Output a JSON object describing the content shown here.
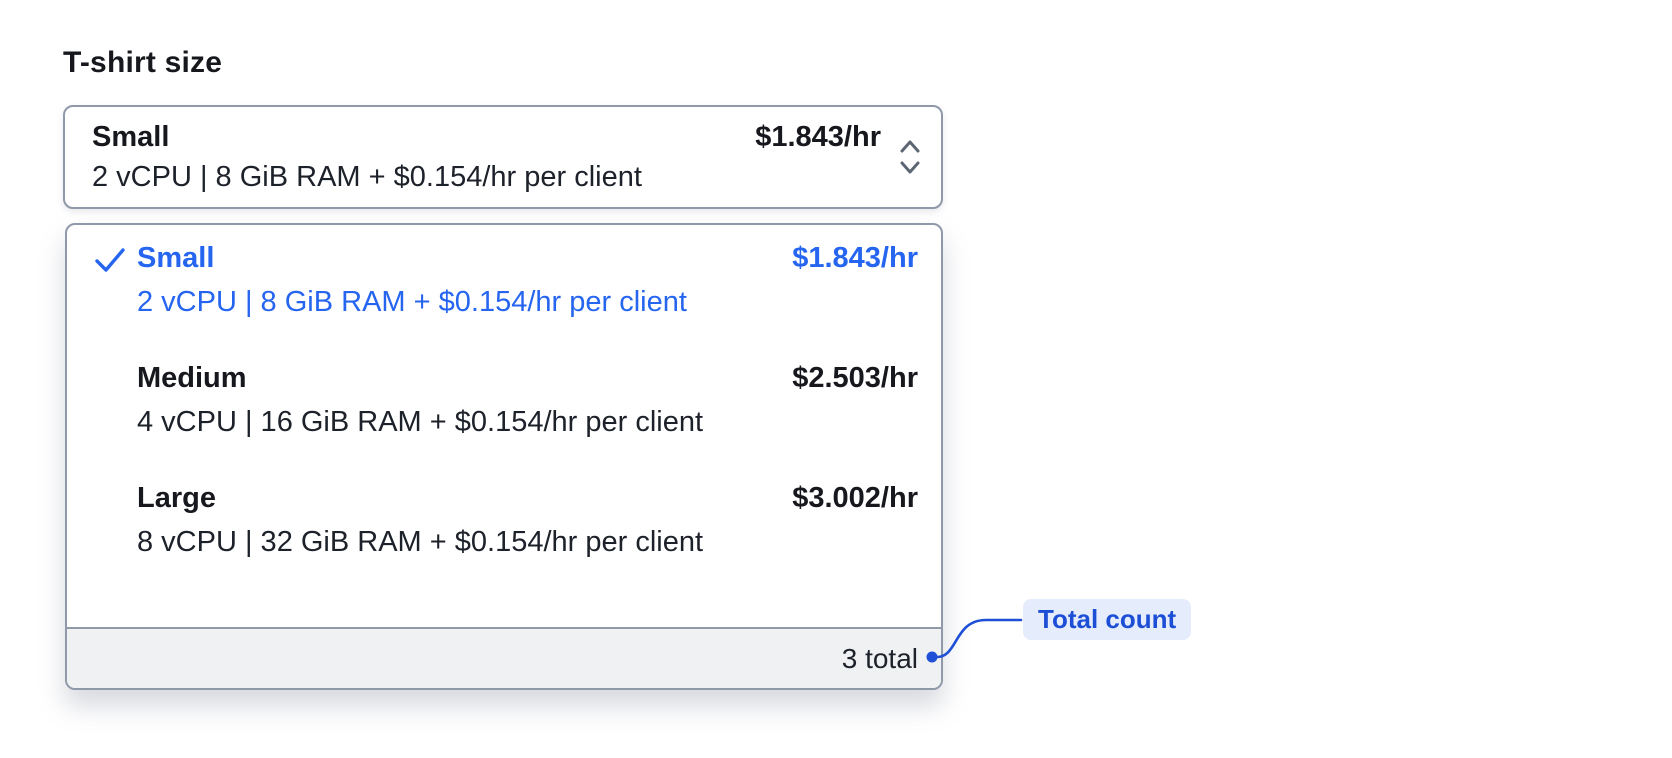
{
  "page": {
    "field_label": "T-shirt size"
  },
  "select_trigger": {
    "title": "Small",
    "subtitle": "2 vCPU | 8 GiB RAM + $0.154/hr per client",
    "price": "$1.843/hr",
    "chevron_icon": "select-updown-chevron"
  },
  "dropdown": {
    "options": [
      {
        "title": "Small",
        "subtitle": "2 vCPU | 8 GiB RAM + $0.154/hr per client",
        "price": "$1.843/hr",
        "selected": true,
        "check_icon": "checkmark"
      },
      {
        "title": "Medium",
        "subtitle": "4 vCPU | 16 GiB RAM + $0.154/hr per client",
        "price": "$2.503/hr",
        "selected": false
      },
      {
        "title": "Large",
        "subtitle": "8 vCPU | 32 GiB RAM + $0.154/hr per client",
        "price": "$3.002/hr",
        "selected": false
      }
    ],
    "footer": {
      "total": "3 total"
    }
  },
  "annotation": {
    "label": "Total count"
  },
  "colors": {
    "selected_blue": "#2565f0",
    "annotation_blue": "#1c4ed6",
    "annotation_bg": "#e5edfc",
    "border_gray": "#8f99a9",
    "footer_bg": "#f0f1f3",
    "text_dark": "#16181d"
  }
}
